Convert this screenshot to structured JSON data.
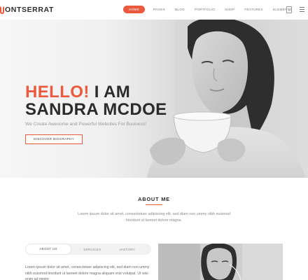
{
  "header": {
    "logo_text": "ONTSERRAT",
    "nav": [
      {
        "label": "HOME",
        "active": true
      },
      {
        "label": "PAGES"
      },
      {
        "label": "BLOG"
      },
      {
        "label": "PORTFOLIO"
      },
      {
        "label": "SHOP"
      },
      {
        "label": "FEATURES"
      },
      {
        "label": "ELEMENTS"
      }
    ],
    "cart_count": "0"
  },
  "hero": {
    "title_highlight": "HELLO!",
    "title_rest": " I AM",
    "title_line2": "SANDRA MCDOE",
    "subtitle": "We Create Awesome and Powerful Websites For Business!",
    "button_label": "DISCOVER BIOGRAPHY"
  },
  "about": {
    "title": "ABOUT ME",
    "text": "Lorem ipsum dolor sit amet, consectetuer adipiscing elit, sed diam non ummy nibh euismod tincidunt ut laoreet dolore magna.",
    "tabs": [
      {
        "label": "ABOUT US",
        "active": true
      },
      {
        "label": "SERVICES"
      },
      {
        "label": "HISTORY"
      }
    ],
    "tab_text": "Lorem ipsum dolor sit amet, consectetuer adipiscing elit, sed diam non ummy nibh euismod tincidunt ut laoreet dolore magna aliquam erat volutpat. Ut wisi enim ad minim"
  },
  "colors": {
    "accent": "#ea5a3e",
    "heading": "#2b2b2b",
    "muted": "#9a9a9a"
  },
  "icons": {
    "cart": "shopping-bag-icon",
    "menu": "hamburger-menu-icon"
  }
}
